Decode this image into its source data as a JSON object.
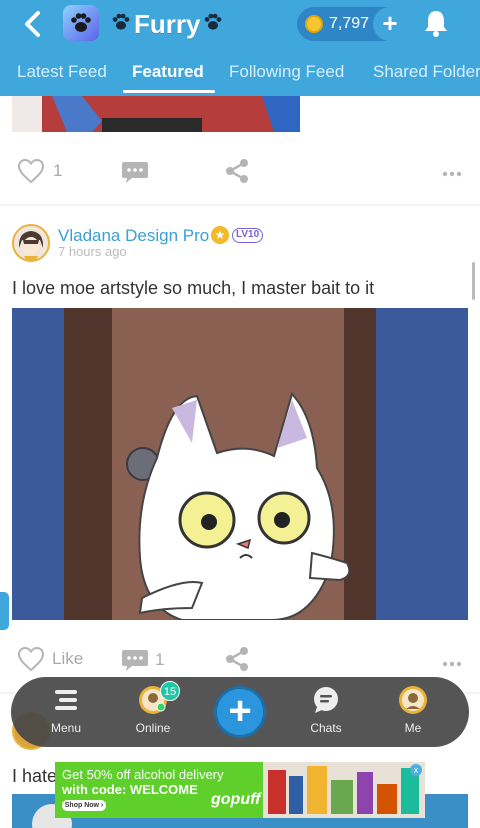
{
  "header": {
    "back_icon": "chevron-left-icon",
    "app_icon": "paw-icon",
    "title": "Furry",
    "coins": "7,797",
    "add_coins_label": "+",
    "bell_icon": "bell-icon"
  },
  "tabs": [
    {
      "label": "Latest Feed"
    },
    {
      "label": "Featured"
    },
    {
      "label": "Following Feed"
    },
    {
      "label": "Shared Folder"
    }
  ],
  "previous_post": {
    "like_count": "1"
  },
  "post": {
    "author": "Vladana Design Pro",
    "level": "LV10",
    "time": "7 hours ago",
    "text": "I love moe artstyle so much, I master bait to it",
    "like_label": "Like",
    "comment_count": "1"
  },
  "next_post": {
    "text_start": "I hate"
  },
  "bottom_nav": {
    "menu_label": "Menu",
    "online_label": "Online",
    "online_count": "15",
    "compose_label": "+",
    "chats_label": "Chats",
    "me_label": "Me"
  },
  "ad": {
    "line1": "Get 50% off alcohol delivery",
    "line2": "with code: WELCOME",
    "shop_label": "Shop Now ›",
    "brand": "gopuff",
    "close_label": "x"
  },
  "colors": {
    "header_blue": "#3fa7dc",
    "link_blue": "#3a9fd4",
    "nav_dark": "#464646",
    "ad_green": "#5ecf2b"
  }
}
